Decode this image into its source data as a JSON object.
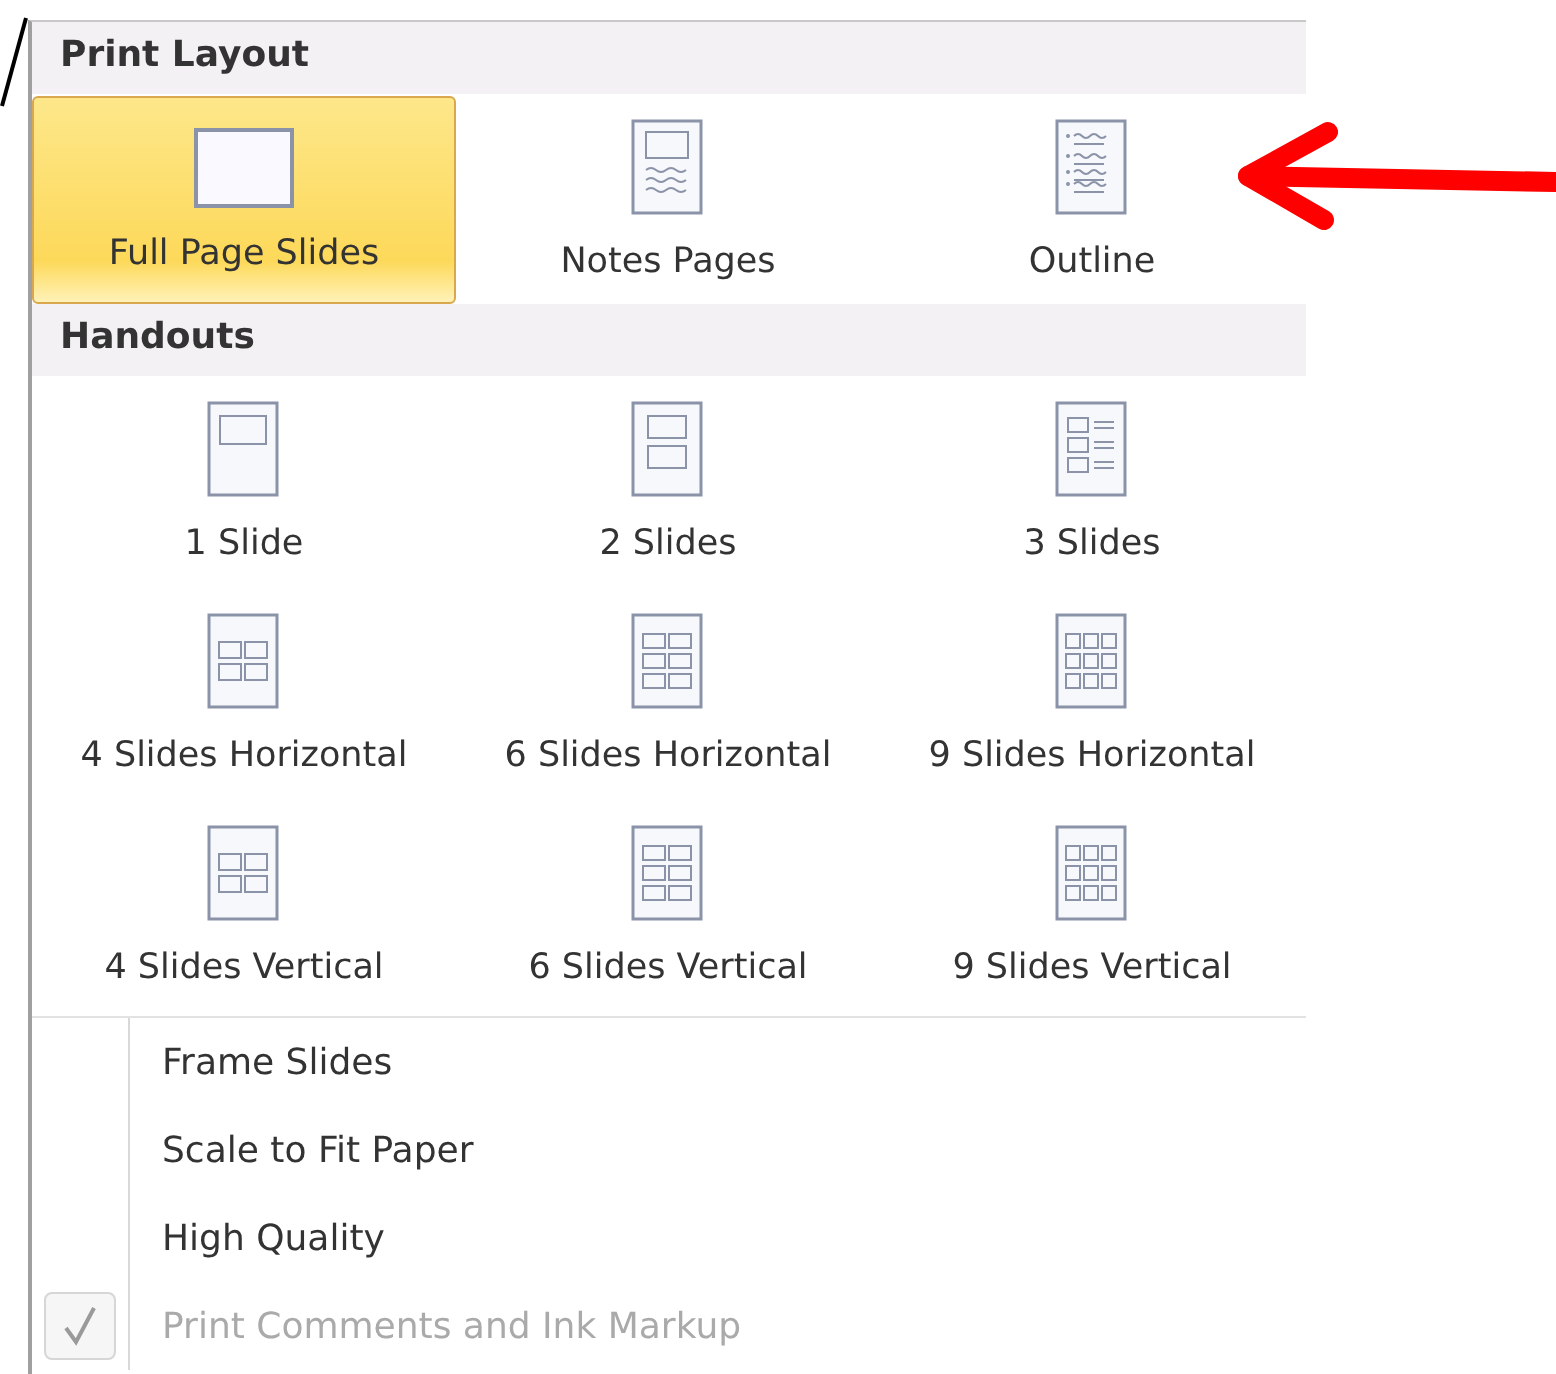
{
  "print_layout": {
    "title": "Print Layout",
    "items": [
      {
        "label": "Full Page Slides",
        "selected": true,
        "kind": "full-page"
      },
      {
        "label": "Notes Pages",
        "selected": false,
        "kind": "notes"
      },
      {
        "label": "Outline",
        "selected": false,
        "kind": "outline"
      }
    ]
  },
  "handouts": {
    "title": "Handouts",
    "items": [
      {
        "label": "1 Slide",
        "selected": false,
        "kind": "h1"
      },
      {
        "label": "2 Slides",
        "selected": false,
        "kind": "h2"
      },
      {
        "label": "3 Slides",
        "selected": false,
        "kind": "h3"
      },
      {
        "label": "4 Slides Horizontal",
        "selected": false,
        "kind": "h4"
      },
      {
        "label": "6 Slides Horizontal",
        "selected": false,
        "kind": "h6"
      },
      {
        "label": "9 Slides Horizontal",
        "selected": false,
        "kind": "h9"
      },
      {
        "label": "4 Slides Vertical",
        "selected": false,
        "kind": "h4"
      },
      {
        "label": "6 Slides Vertical",
        "selected": false,
        "kind": "h6"
      },
      {
        "label": "9 Slides Vertical",
        "selected": false,
        "kind": "h9"
      }
    ]
  },
  "options": [
    {
      "label": "Frame Slides",
      "checked": false,
      "disabled": false
    },
    {
      "label": "Scale to Fit Paper",
      "checked": false,
      "disabled": false
    },
    {
      "label": "High Quality",
      "checked": false,
      "disabled": false
    },
    {
      "label": "Print Comments and Ink Markup",
      "checked": true,
      "disabled": true
    }
  ]
}
